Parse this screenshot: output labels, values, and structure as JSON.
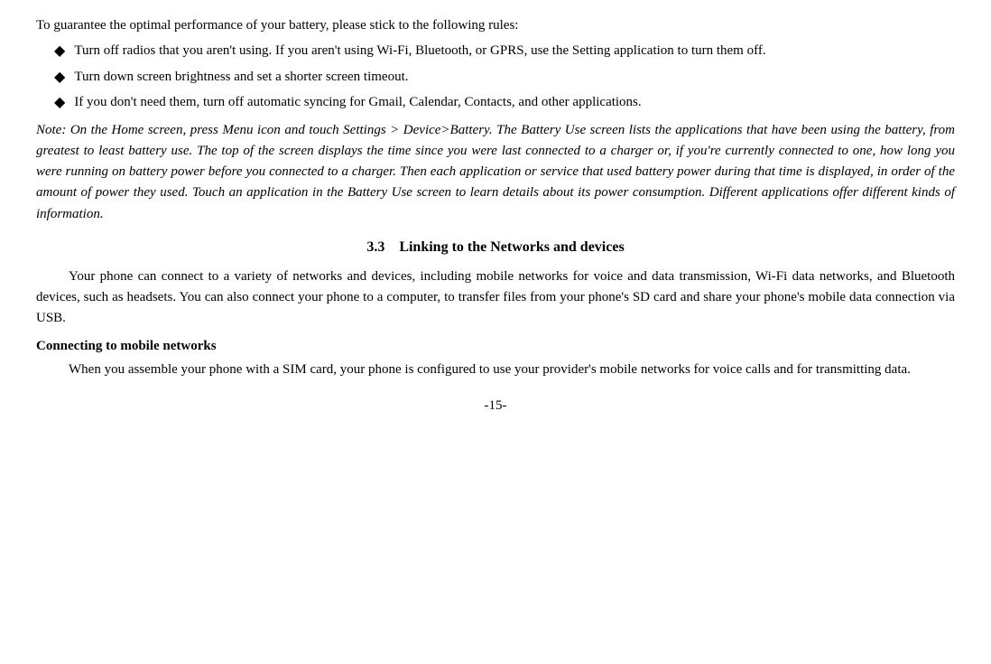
{
  "intro": {
    "line": "To guarantee the optimal performance of your battery, please stick to the following rules:"
  },
  "bullets": [
    {
      "text": "Turn off radios that you aren't using. If you aren't using Wi-Fi, Bluetooth, or GPRS, use the Setting application to turn them off."
    },
    {
      "text": "Turn down screen brightness and set a shorter screen timeout."
    },
    {
      "text": "If you don't need them, turn off automatic syncing for Gmail, Calendar, Contacts, and other applications."
    }
  ],
  "note": {
    "text": "Note: On the Home screen, press Menu icon and touch Settings > Device>Battery. The Battery Use screen lists the applications that have been using the battery, from greatest to least battery use. The top of the screen displays the time since you were last connected to a charger or, if you're currently connected to one, how long you were running on battery power before you connected to a charger. Then each application or service that used battery power during that time is displayed, in order of the amount of power they used. Touch an application in the Battery Use screen to learn details about its power consumption. Different applications offer different kinds of information."
  },
  "section": {
    "number": "3.3",
    "title": "Linking to the Networks and devices"
  },
  "main_paragraph": {
    "text": "Your phone can connect to a variety of networks and devices, including mobile networks for voice and data transmission, Wi-Fi data networks, and Bluetooth devices, such as headsets. You can also connect your phone to a computer, to transfer files from your phone's SD card and share your phone's mobile data connection via USB."
  },
  "sub_section": {
    "heading": "Connecting to mobile networks",
    "paragraph": "When you assemble your phone with a SIM card, your phone is configured to use your provider's mobile networks for voice calls and for transmitting data."
  },
  "page_number": {
    "text": "-15-"
  }
}
